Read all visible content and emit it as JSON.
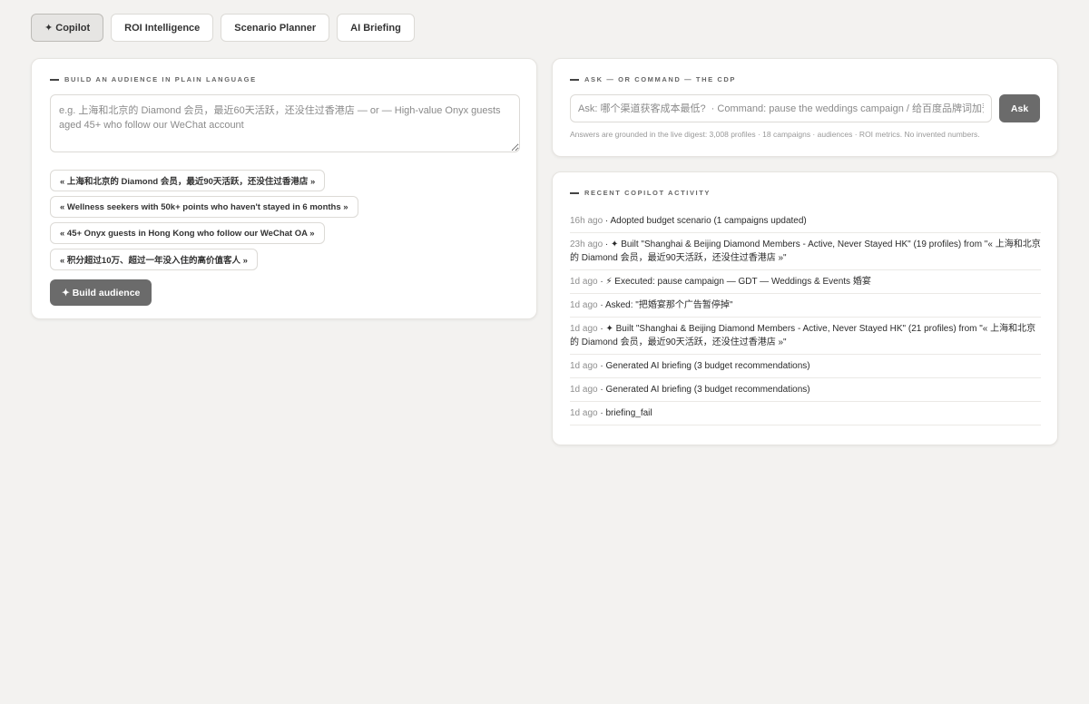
{
  "tabs": [
    {
      "label": "✦ Copilot",
      "active": true
    },
    {
      "label": "ROI Intelligence",
      "active": false
    },
    {
      "label": "Scenario Planner",
      "active": false
    },
    {
      "label": "AI Briefing",
      "active": false
    }
  ],
  "audience": {
    "title": "Build an audience in plain language",
    "placeholder": "e.g. 上海和北京的 Diamond 会员，最近60天活跃，还没住过香港店 — or — High-value Onyx guests aged 45+ who follow our WeChat account",
    "chips": [
      "« 上海和北京的 Diamond 会员，最近90天活跃，还没住过香港店 »",
      "« Wellness seekers with 50k+ points who haven't stayed in 6 months »",
      "« 45+ Onyx guests in Hong Kong who follow our WeChat OA »",
      "« 积分超过10万、超过一年没入住的高价值客人 »"
    ],
    "build_label": "✦ Build audience"
  },
  "ask": {
    "title": "Ask — or command — the CDP",
    "placeholder": "Ask: 哪个渠道获客成本最低?  · Command: pause the weddings campaign / 给百度品牌词加预算",
    "button_label": "Ask",
    "note": "Answers are grounded in the live digest: 3,008 profiles · 18 campaigns · audiences · ROI metrics. No invented numbers."
  },
  "activity": {
    "title": "Recent copilot activity",
    "items": [
      {
        "time": "16h ago",
        "text": "Adopted budget scenario (1 campaigns updated)"
      },
      {
        "time": "23h ago",
        "text": "✦ Built \"Shanghai & Beijing Diamond Members - Active, Never Stayed HK\" (19 profiles) from \"« 上海和北京的 Diamond 会员，最近90天活跃，还没住过香港店 »\""
      },
      {
        "time": "1d ago",
        "text": "⚡ Executed: pause campaign — GDT — Weddings & Events 婚宴"
      },
      {
        "time": "1d ago",
        "text": "Asked: \"把婚宴那个广告暂停掉\""
      },
      {
        "time": "1d ago",
        "text": "✦ Built \"Shanghai & Beijing Diamond Members - Active, Never Stayed HK\" (21 profiles) from \"« 上海和北京的 Diamond 会员，最近90天活跃，还没住过香港店 »\""
      },
      {
        "time": "1d ago",
        "text": "Generated AI briefing (3 budget recommendations)"
      },
      {
        "time": "1d ago",
        "text": "Generated AI briefing (3 budget recommendations)"
      },
      {
        "time": "1d ago",
        "text": "briefing_fail"
      }
    ]
  },
  "colors": {
    "background": "#f3f2f0",
    "primary_button": "#6b6b6b",
    "bolt_accent": "#e8872a"
  }
}
